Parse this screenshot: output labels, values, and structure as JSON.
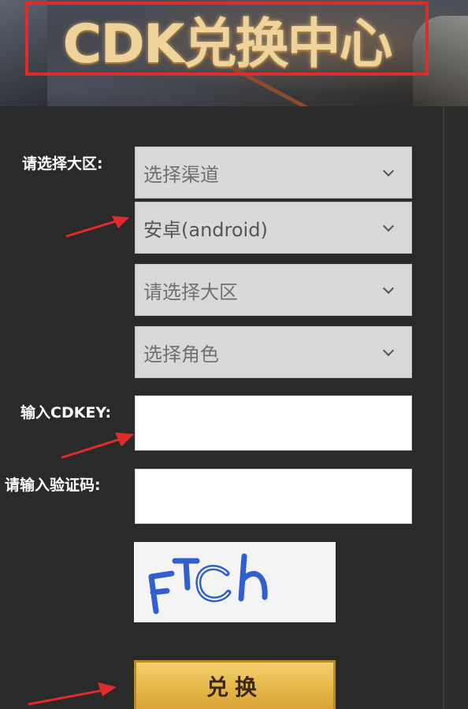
{
  "banner": {
    "title": "CDK兑换中心"
  },
  "form": {
    "region_label": "请选择大区:",
    "channel_select": {
      "value": "选择渠道"
    },
    "platform_select": {
      "value": "安卓(android)"
    },
    "region_select": {
      "value": "请选择大区"
    },
    "role_select": {
      "value": "选择角色"
    },
    "cdkey_label": "输入CDKEY:",
    "cdkey_value": "",
    "captcha_label": "请输入验证码:",
    "captcha_value": "",
    "captcha_image_text": "FTCh",
    "submit_label": "兑换"
  },
  "colors": {
    "annotation_red": "#e12a2a",
    "button_gold": "#e6b74a",
    "captcha_blue": "#2f5fd0"
  }
}
